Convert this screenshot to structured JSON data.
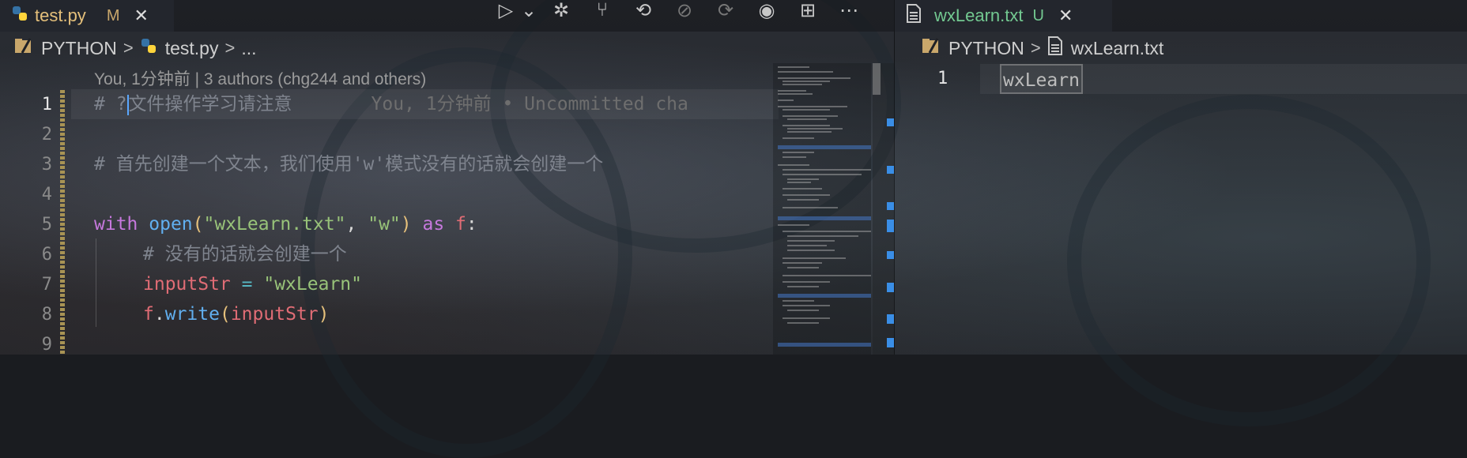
{
  "left_editor": {
    "tab": {
      "filename": "test.py",
      "status": "M",
      "close": "✕"
    },
    "breadcrumb": {
      "folder": "PYTHON",
      "file": "test.py",
      "more": "..."
    },
    "codelens": "You, 1分钟前 | 3 authors (chg244 and others)",
    "lines": [
      {
        "n": "1"
      },
      {
        "n": "2"
      },
      {
        "n": "3"
      },
      {
        "n": "4"
      },
      {
        "n": "5"
      },
      {
        "n": "6"
      },
      {
        "n": "7"
      },
      {
        "n": "8"
      },
      {
        "n": "9"
      }
    ],
    "code": {
      "l1_comment_a": "# ?",
      "l1_comment_b": "文件操作学习请注意",
      "l1_blame": "You, 1分钟前 • Uncommitted cha",
      "l3_comment_a": "# 首先创建一个文本，我们使用",
      "l3_comment_b": "'w'",
      "l3_comment_c": "模式没有的话就会创建一个",
      "l5_with": "with",
      "l5_open": "open",
      "l5_paren": "(",
      "l5_str1": "\"wxLearn.txt\"",
      "l5_comma": ", ",
      "l5_str2": "\"w\"",
      "l5_paren2": ")",
      "l5_as": "as",
      "l5_f": "f",
      "l5_colon": ":",
      "l6_comment": "# 没有的话就会创建一个",
      "l7_var": "inputStr",
      "l7_eq": "=",
      "l7_str": "\"wxLearn\"",
      "l8_f": "f",
      "l8_dot": ".",
      "l8_write": "write",
      "l8_p1": "(",
      "l8_arg": "inputStr",
      "l8_p2": ")"
    }
  },
  "right_editor": {
    "tab": {
      "filename": "wxLearn.txt",
      "status": "U",
      "close": "✕"
    },
    "breadcrumb": {
      "folder": "PYTHON",
      "file": "wxLearn.txt"
    },
    "line_number": "1",
    "content": "wxLearn"
  },
  "toolbar": {
    "icons": [
      "run-icon",
      "dropdown-icon",
      "debug-icon",
      "source-control-icon",
      "timeline-icon",
      "compare-icon",
      "history-icon",
      "toggle-icon",
      "split-editor-icon",
      "more-icon"
    ],
    "glyphs": [
      "▷",
      "⌄",
      "✲",
      "⑂",
      "⟲",
      "⊘",
      "⟳",
      "◉",
      "⊞",
      "⋯"
    ]
  },
  "colors": {
    "accent_blue": "#3a8ee6",
    "python_blue": "#3572A5",
    "python_yellow": "#FFD43B",
    "modified_status": "#c9a76b",
    "untracked_status": "#73c991"
  }
}
